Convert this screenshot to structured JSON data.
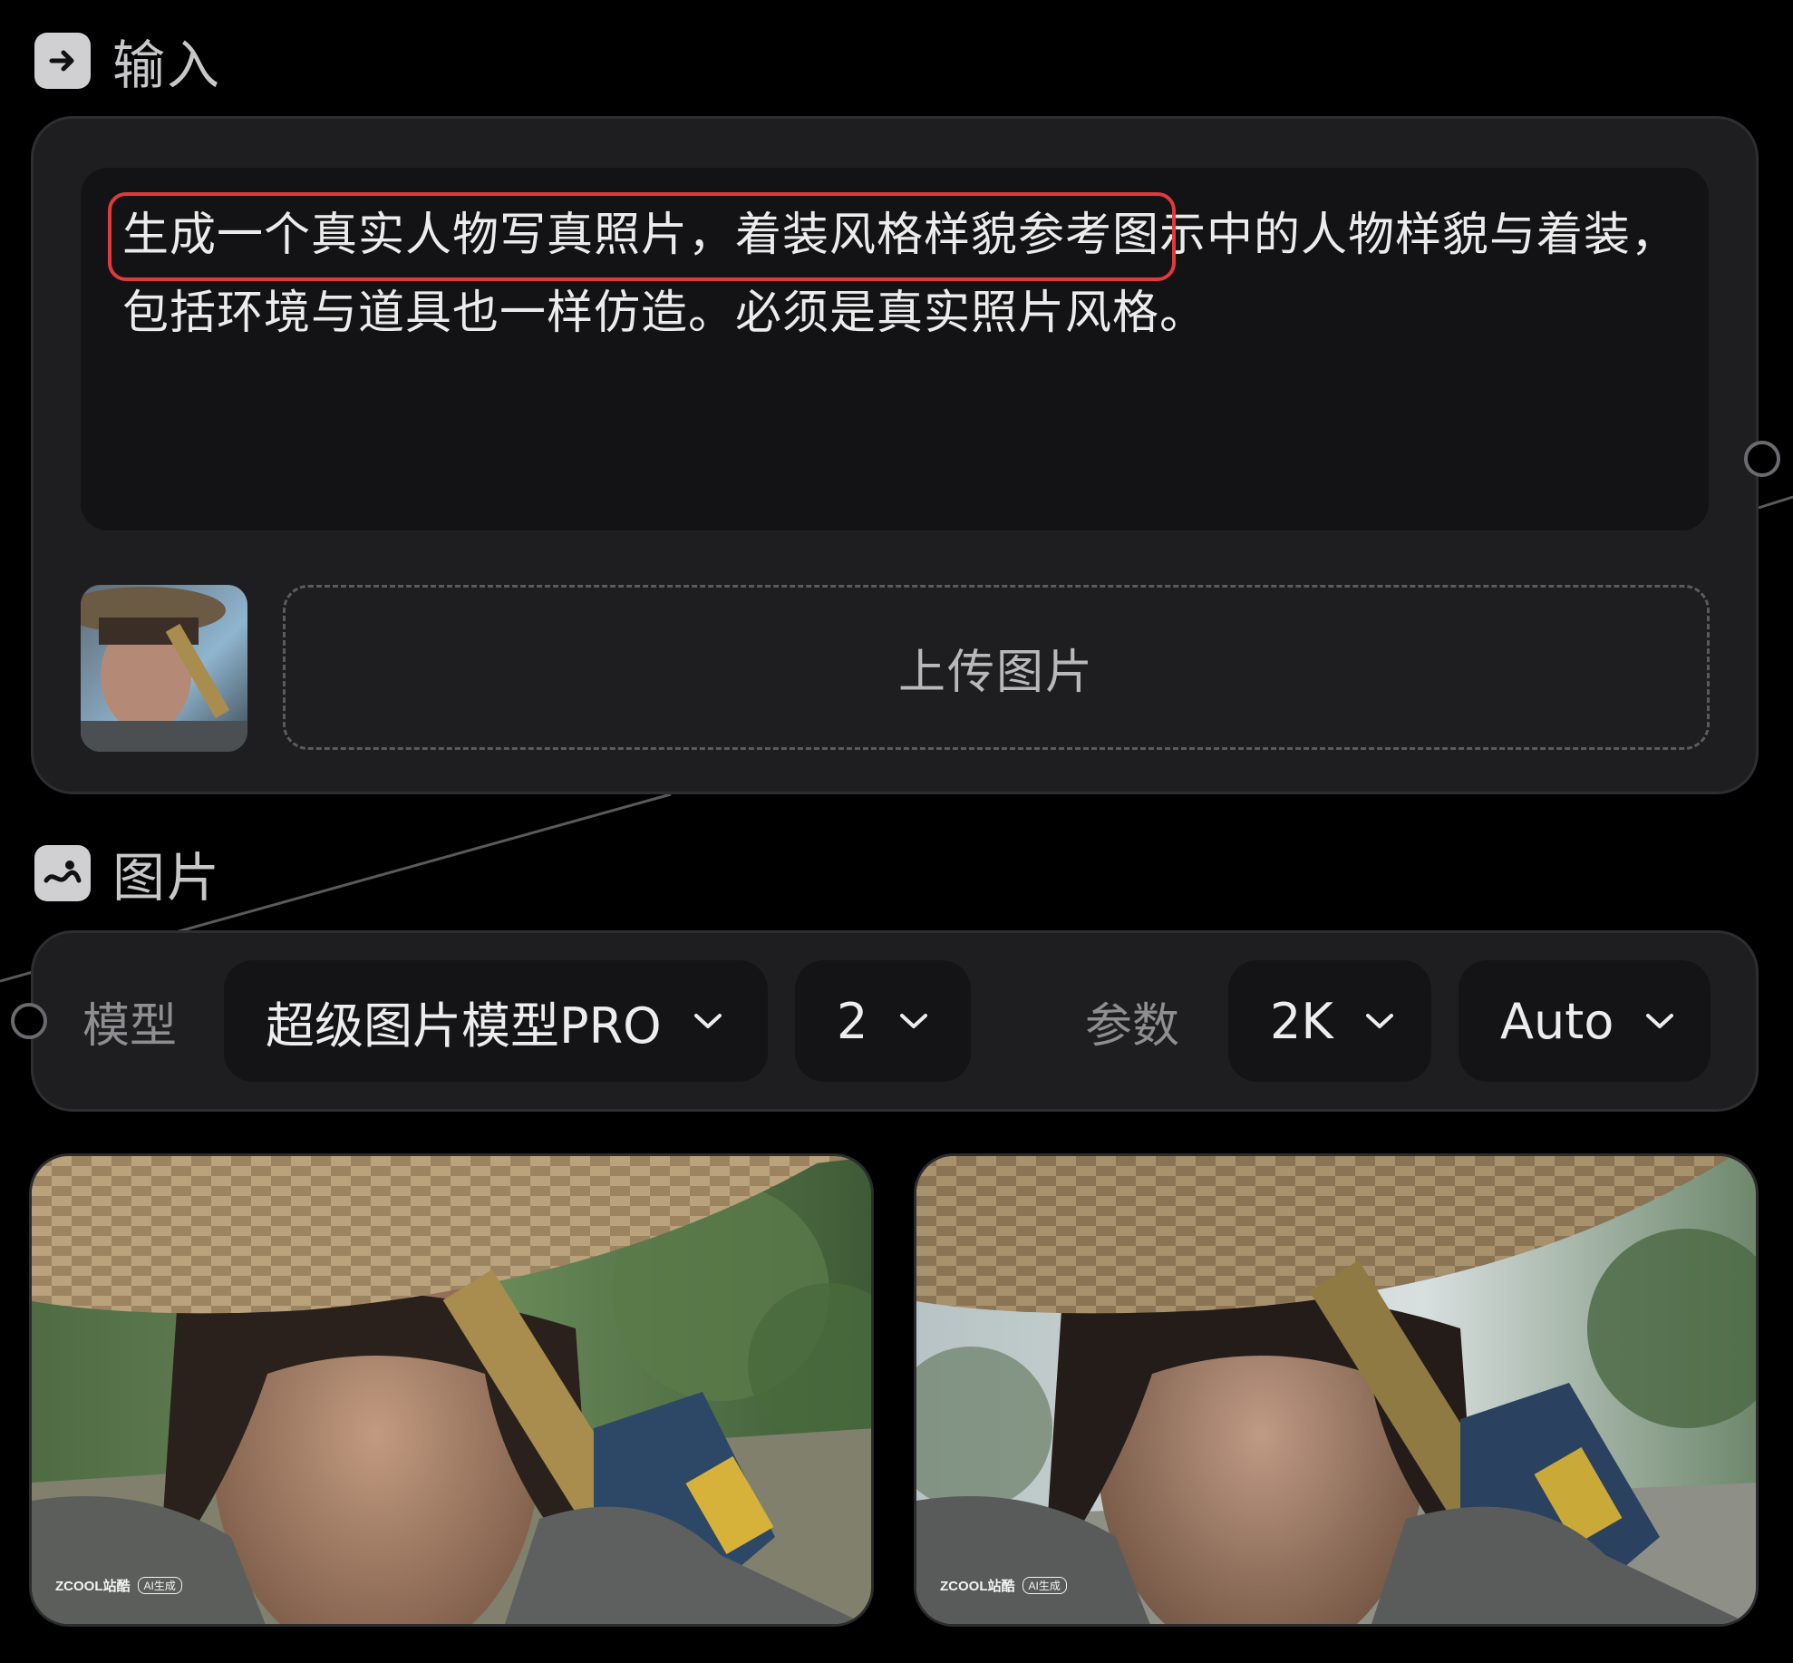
{
  "input_section": {
    "title": "输入",
    "icon": "arrow-right-icon",
    "prompt_text": "生成一个真实人物写真照片，着装风格样貌参考图示中的人物样貌与着装，包括环境与道具也一样仿造。必须是真实照片风格。",
    "upload_label": "上传图片",
    "highlight_color": "#e03a3e"
  },
  "image_section": {
    "title": "图片",
    "icon": "image-icon",
    "model_label": "模型",
    "model_value": "超级图片模型PRO",
    "count_value": "2",
    "params_label": "参数",
    "resolution_value": "2K",
    "ratio_value": "Auto"
  },
  "results": [
    {
      "watermark_brand": "ZCOOL站酷",
      "watermark_tag": "AI生成"
    },
    {
      "watermark_brand": "ZCOOL站酷",
      "watermark_tag": "AI生成"
    }
  ]
}
